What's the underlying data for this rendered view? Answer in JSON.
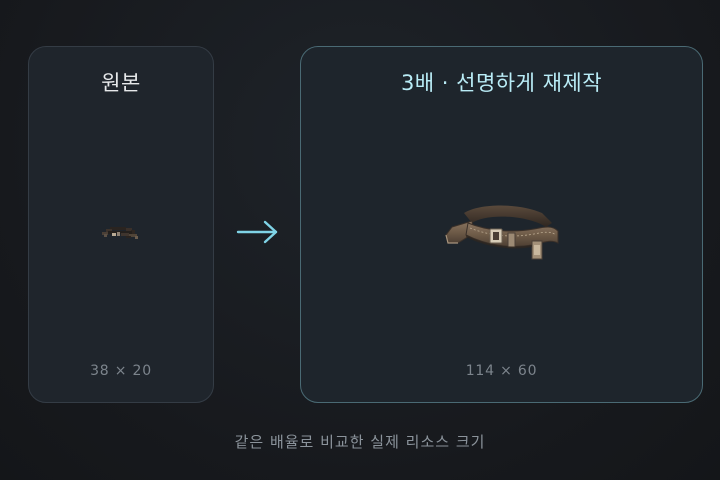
{
  "original": {
    "title": "원본",
    "size_label": "38 × 20",
    "image_icon": "belt-sprite-icon"
  },
  "arrow_icon": "right-arrow-icon",
  "upscaled": {
    "title": "3배 · 선명하게 재제작",
    "size_label": "114 × 60",
    "image_icon": "belt-sprite-icon"
  },
  "caption": "같은 배율로 비교한 실제 리소스 크기",
  "colors": {
    "background": "#17191d",
    "panel": "#1f252c",
    "accent_border": "#4a6a74",
    "accent_text": "#b9ecf6",
    "arrow": "#7fd3e6"
  }
}
